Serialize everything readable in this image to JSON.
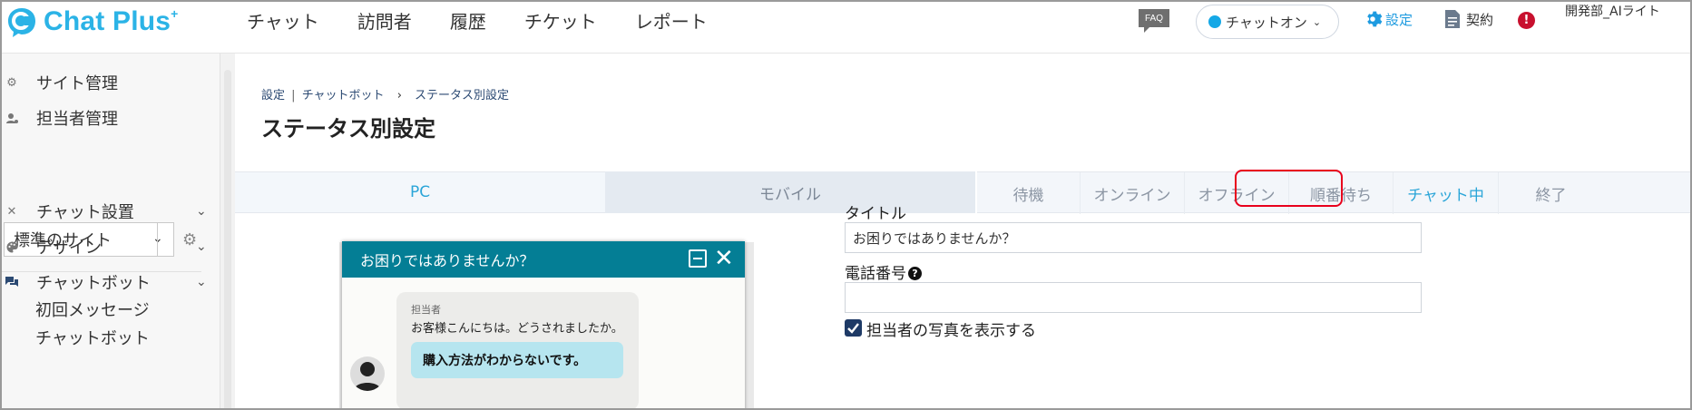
{
  "app": {
    "logo_text": "Chat Plus",
    "logo_sup": "+"
  },
  "nav": {
    "items": [
      {
        "label": "チャット"
      },
      {
        "label": "訪問者"
      },
      {
        "label": "履歴"
      },
      {
        "label": "チケット"
      },
      {
        "label": "レポート"
      }
    ]
  },
  "topbar": {
    "faq_label": "FAQ",
    "chat_status": "チャットオン",
    "settings_label": "設定",
    "contract_label": "契約",
    "alert_text": "!",
    "user_name": "開発部_AIライト"
  },
  "sidebar": {
    "site_admin": "サイト管理",
    "staff_admin": "担当者管理",
    "site_select_value": "標準のサイト",
    "chat_install": "チャット設置",
    "design": "デザイン",
    "chatbot": "チャットボット",
    "sub_first_message": "初回メッセージ",
    "sub_chatbot": "チャットボット"
  },
  "main": {
    "breadcrumb": {
      "part1": "設定",
      "sep1": "|",
      "part2": "チャットボット",
      "sep2": "›",
      "part3": "ステータス別設定"
    },
    "title": "ステータス別設定",
    "device_tabs": {
      "pc": "PC",
      "mobile": "モバイル"
    },
    "status_tabs": [
      {
        "label": "待機"
      },
      {
        "label": "オンライン"
      },
      {
        "label": "オフライン"
      },
      {
        "label": "順番待ち"
      },
      {
        "label": "チャット中"
      },
      {
        "label": "終了"
      }
    ],
    "active_status": "チャット中"
  },
  "preview": {
    "header_title": "お困りではありませんか？",
    "agent_label": "担当者",
    "agent_message": "お客様こんにちは。どうされましたか。",
    "choice_text": "購入方法がわからないです。"
  },
  "form": {
    "title_label": "タイトル",
    "title_value": "お困りではありませんか？",
    "phone_label": "電話番号",
    "phone_value": "",
    "show_photo_label": "担当者の写真を表示する",
    "show_photo_checked": true
  },
  "colors": {
    "brand": "#2bb3e6",
    "widget_header": "#047e95",
    "active_tab_text": "#2aa5d8",
    "highlight_red": "#e8001c"
  }
}
